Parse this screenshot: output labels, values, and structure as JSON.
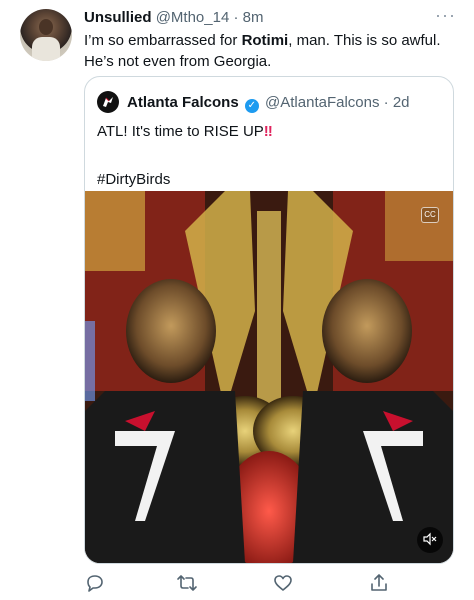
{
  "tweet": {
    "author_name": "Unsullied",
    "handle": "@Mtho_14",
    "separator": "·",
    "time": "8m",
    "text_before": "I’m so embarrassed for ",
    "text_bold": "Rotimi",
    "text_after": ", man. This is so awful. He’s not even from Georgia."
  },
  "quoted": {
    "author_name": "Atlanta Falcons",
    "handle": "@AtlantaFalcons",
    "separator": "·",
    "time": "2d",
    "line1": "ATL! It's time to RISE UP",
    "line1_emoji": "‼",
    "hashtag": "#DirtyBirds"
  },
  "media": {
    "captions_icon": "captions-icon",
    "mute_icon": "mute-icon"
  },
  "actions": {
    "reply_icon": "reply-icon",
    "retweet_icon": "retweet-icon",
    "like_icon": "like-icon",
    "share_icon": "share-icon"
  },
  "colors": {
    "text": "#0f1419",
    "muted": "#536471",
    "verified": "#1d9bf0",
    "border": "#cfd9de"
  }
}
